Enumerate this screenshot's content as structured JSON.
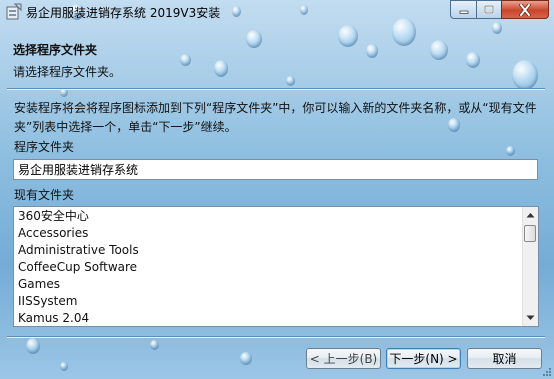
{
  "window": {
    "title": "易企用服装进销存系统 2019V3安装"
  },
  "header": {
    "title": "选择程序文件夹",
    "subtitle": "请选择程序文件夹。"
  },
  "body": {
    "description": "安装程序将会将程序图标添加到下列“程序文件夹”中，你可以输入新的文件夹名称，或从“现有文件夹”列表中选择一个，单击“下一步”继续。",
    "program_folder_label": "程序文件夹",
    "program_folder_value": "易企用服装进销存系统",
    "existing_folders_label": "现有文件夹",
    "existing_folders": [
      "360安全中心",
      "Accessories",
      "Administrative Tools",
      "CoffeeCup Software",
      "Games",
      "IISSystem",
      "Kamus 2.04"
    ]
  },
  "buttons": {
    "back": "< 上一步(B)",
    "next": "下一步(N) >",
    "cancel": "取消"
  }
}
